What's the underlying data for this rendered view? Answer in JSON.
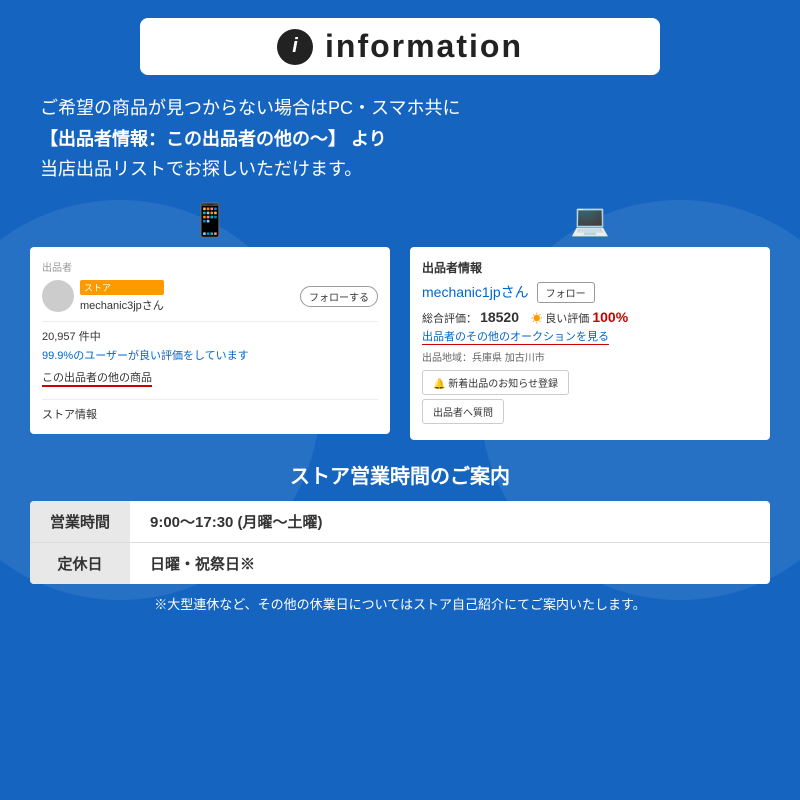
{
  "header": {
    "title": "information",
    "icon_label": "i"
  },
  "description": {
    "line1": "ご希望の商品が見つからない場合はPC・スマホ共に",
    "line2": "【出品者情報：この出品者の他の〜】 より",
    "line3": "当店出品リストでお探しいただけます。"
  },
  "left_panel": {
    "section_label": "出品者",
    "store_badge": "ストア",
    "seller_name": "mechanic3jpさん",
    "follow_btn": "フォローする",
    "count": "20,957 件中",
    "rating_text": "99.9%のユーザーが良い評価をしています",
    "link_text": "この出品者の他の商品",
    "store_info": "ストア情報"
  },
  "right_panel": {
    "section_label": "出品者情報",
    "seller_name": "mechanic1jpさん",
    "follow_btn": "フォロー",
    "eval_label": "総合評価：",
    "eval_score": "18520",
    "eval_good_icon": "☀",
    "eval_good_label": "良い評価",
    "eval_pct": "100%",
    "auction_link": "出品者のその他のオークションを見る",
    "region_label": "出品地域：兵庫県 加古川市",
    "new_item_btn": "🔔 新着出品のお知らせ登録",
    "question_btn": "出品者へ質問"
  },
  "store_hours": {
    "title": "ストア営業時間のご案内",
    "rows": [
      {
        "label": "営業時間",
        "value": "9:00〜17:30 (月曜〜土曜)"
      },
      {
        "label": "定休日",
        "value": "日曜・祝祭日※"
      }
    ],
    "note": "※大型連休など、その他の休業日についてはストア自己紹介にてご案内いたします。"
  },
  "colors": {
    "background": "#1565c0",
    "white": "#ffffff",
    "blue_link": "#0066cc",
    "red": "#cc0000",
    "orange": "#f90"
  }
}
